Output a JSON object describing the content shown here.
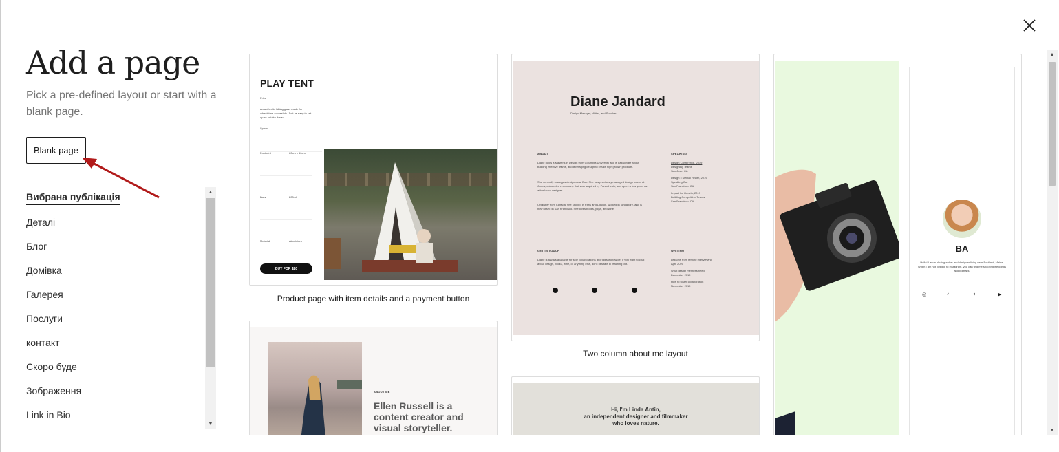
{
  "header": {
    "title": "Add a page",
    "subtitle": "Pick a pre-defined layout or start with a blank page.",
    "blank_button": "Blank page"
  },
  "categories": [
    {
      "label": "Вибрана публікація",
      "active": true
    },
    {
      "label": "Деталі"
    },
    {
      "label": "Блог"
    },
    {
      "label": "Домівка"
    },
    {
      "label": "Галерея"
    },
    {
      "label": "Послуги"
    },
    {
      "label": "контакт"
    },
    {
      "label": "Скоро буде"
    },
    {
      "label": "Зображення"
    },
    {
      "label": "Link in Bio"
    }
  ],
  "cards": {
    "product": {
      "caption": "Product page with item details and a payment button",
      "heading": "PLAY TENT",
      "price_label": "Price",
      "description": "An authentic hiking glass made for wheelchair accessible. Just as easy to set up as to take down.",
      "specs_label": "Specs",
      "specs": [
        {
          "label": "Footprint",
          "value": "60cm x 60cm"
        },
        {
          "label": "Bars",
          "value": "200ml"
        },
        {
          "label": "Material",
          "value": "Aluminium"
        }
      ],
      "buy_button": "BUY FOR $20"
    },
    "about_two_col": {
      "caption": "Two column about me layout",
      "name": "Diane Jandard",
      "role": "Design Manager, Writer, and Speaker",
      "about_label": "ABOUT",
      "about_text_1": "Diane holds a Master's in Design from Columbia University and is passionate about building effective teams, and leveraging design to create high growth products.",
      "about_text_2": "She currently manages designers at Doc. She has previously managed design teams at Jimow, cofounded a company that was acquired by Parenthesis, and spent a few years as a freelance designer.",
      "about_text_3": "Originally from Canada, she studied in Paris and London, worked in Singapore, and is now based in San Francisco. She loves books, yoga, and wine.",
      "speaking_label": "SPEAKING",
      "speaking": [
        "Design Conference, 2019",
        "Designing Teams",
        "San Jose, CA",
        "Design x Mental Health, 2019",
        "Speaking Out",
        "San Francisco, CA",
        "Impact for Growth, 2019",
        "Building Competitive Teams",
        "San Francisco, CA"
      ],
      "contact_label": "GET IN TOUCH",
      "contact_text": "Diane is always available for side collaborations and talks worldwide. If you want to chat about design, books, wine, or anything else, don't hesitate in reaching out.",
      "writing_label": "WRITING",
      "writing": [
        "Lessons from remote interviewing",
        "April 2020",
        "What design mentees need",
        "December 2019",
        "How to foster collaboration",
        "November 2019"
      ]
    },
    "link_in_bio": {
      "name": "BA",
      "bio": "Hello! I am a photographer and designer living near Portland, Maine. When I am not posting to Instagram, you can find me shooting weddings and portraits."
    },
    "ellen": {
      "eyebrow": "ABOUT ME",
      "headline_1": "Ellen Russell is a",
      "headline_2": "content creator and",
      "headline_3": "visual storyteller."
    },
    "linda": {
      "line_1": "Hi, I'm Linda Antin,",
      "line_2": "an independent designer and filmmaker",
      "line_3": "who loves nature."
    }
  },
  "colors": {
    "accent_arrow": "#b11a1a",
    "about_bg": "#ebe2e0",
    "bio_bg": "#e9f9df",
    "linda_bg": "#e2e0da"
  }
}
